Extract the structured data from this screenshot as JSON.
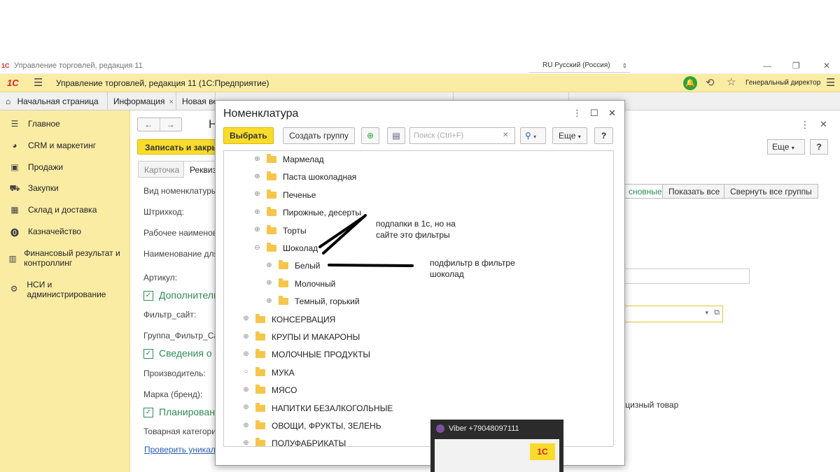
{
  "os": {
    "title": "Управление торговлей, редакция 11",
    "logo": "1С",
    "lang": "RU Русский (Россия)",
    "min_icon": "minimize-icon",
    "restore_icon": "restore-icon",
    "close_icon": "close-icon"
  },
  "header": {
    "logo": "1С",
    "title": "Управление торговлей, редакция 11  (1С:Предприятие)",
    "user": "Генеральный директор",
    "bell_color": "#2aa43a"
  },
  "tabs": [
    {
      "label": "Начальная страница"
    },
    {
      "label": "Информация",
      "close": "×"
    },
    {
      "label": "Новая ве"
    },
    {
      "label": ""
    },
    {
      "label": ""
    }
  ],
  "sidebar": {
    "items": [
      {
        "label": "Главное",
        "icon": "menu-icon"
      },
      {
        "label": "CRM и маркетинг",
        "icon": "pie-chart-icon"
      },
      {
        "label": "Продажи",
        "icon": "bag-icon"
      },
      {
        "label": "Закупки",
        "icon": "cart-icon"
      },
      {
        "label": "Склад и доставка",
        "icon": "grid-icon"
      },
      {
        "label": "Казначейство",
        "icon": "coin-icon"
      },
      {
        "label": "Финансовый результат и контроллинг",
        "icon": "bar-chart-icon"
      },
      {
        "label": "НСИ и администрирование",
        "icon": "gear-icon"
      }
    ]
  },
  "form": {
    "title_letter": "Н",
    "save_label": "Записать и закры",
    "tabs": [
      "Карточка",
      "Реквиз"
    ],
    "labels": {
      "vid": "Вид номенклатуры:",
      "barcode": "Штрихкод:",
      "work_name": "Рабочее наименова",
      "print_name": "Наименование для",
      "article": "Артикул:",
      "filter_site": "Фильтр_сайт:",
      "group_filter": "Группа_Фильтр_Са",
      "producer": "Производитель:",
      "brand": "Марка (бренд):",
      "product_category": "Товарная категория"
    },
    "sections": {
      "additional": "Дополнитель",
      "info": "Сведения о",
      "planning": "Планирован"
    },
    "check_link": "Проверить уникаль",
    "right_buttons": [
      "сновные",
      "Показать все",
      "Свернуть все группы"
    ],
    "more_label": "Еще",
    "help_label": "?",
    "excise_text": "кцизный товар",
    "dot_mark": "."
  },
  "modal": {
    "title": "Номенклатура",
    "buttons": {
      "select": "Выбрать",
      "create_group": "Создать группу",
      "more": "Еще",
      "help": "?"
    },
    "search_placeholder": "Поиск (Ctrl+F)",
    "tree": [
      {
        "label": "Мармелад",
        "level": 2,
        "expander": "plus"
      },
      {
        "label": "Паста шоколадная",
        "level": 2,
        "expander": "plus"
      },
      {
        "label": "Печенье",
        "level": 2,
        "expander": "plus"
      },
      {
        "label": "Пирожные, десерты",
        "level": 2,
        "expander": "plus"
      },
      {
        "label": "Торты",
        "level": 2,
        "expander": "plus"
      },
      {
        "label": "Шоколад",
        "level": 2,
        "expander": "minus"
      },
      {
        "label": "Белый",
        "level": 3,
        "expander": "plus"
      },
      {
        "label": "Молочный",
        "level": 3,
        "expander": "plus"
      },
      {
        "label": "Темный, горький",
        "level": 3,
        "expander": "plus"
      },
      {
        "label": "КОНСЕРВАЦИЯ",
        "level": 1,
        "expander": "plus"
      },
      {
        "label": "КРУПЫ И МАКАРОНЫ",
        "level": 1,
        "expander": "plus"
      },
      {
        "label": "МОЛОЧНЫЕ ПРОДУКТЫ",
        "level": 1,
        "expander": "plus"
      },
      {
        "label": "МУКА",
        "level": 1,
        "expander": "circle"
      },
      {
        "label": "МЯСО",
        "level": 1,
        "expander": "plus"
      },
      {
        "label": "НАПИТКИ БЕЗАЛКОГОЛЬНЫЕ",
        "level": 1,
        "expander": "plus"
      },
      {
        "label": "ОВОЩИ, ФРУКТЫ, ЗЕЛЕНЬ",
        "level": 1,
        "expander": "plus"
      },
      {
        "label": "ПОЛУФАБРИКАТЫ",
        "level": 1,
        "expander": "plus"
      }
    ]
  },
  "annotations": {
    "note1_line1": "подпапки в 1с, но на",
    "note1_line2": "сайте это фильтры",
    "note2_line1": "подфильтр в фильтре",
    "note2_line2": "шоколад"
  },
  "viber": {
    "title": "Viber +79048097111",
    "thumb_logo": "1С"
  }
}
